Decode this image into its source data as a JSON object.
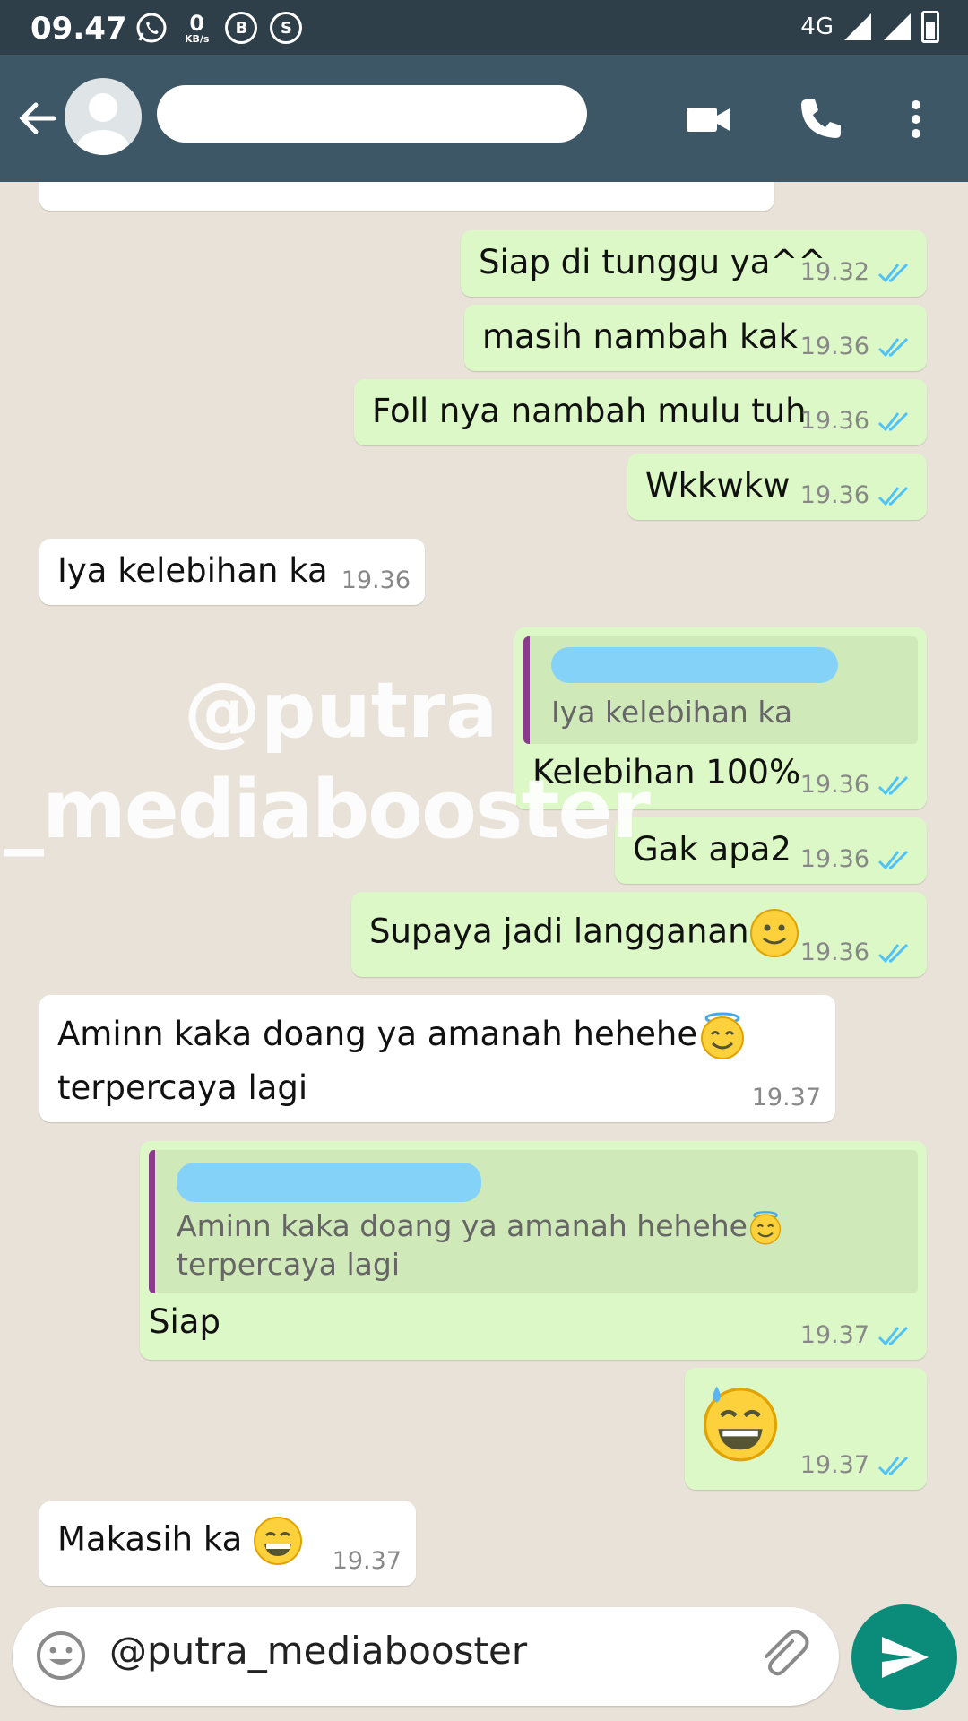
{
  "status_bar": {
    "time": "09.47",
    "net_speed": "0",
    "net_unit": "KB/s",
    "b_badge": "B",
    "s_badge": "S",
    "network": "4G"
  },
  "header": {
    "back_icon": "arrow-left-icon",
    "video_icon": "video-icon",
    "call_icon": "phone-icon",
    "menu_icon": "more-vert-icon"
  },
  "messages": [
    {
      "dir": "out",
      "text": "Siap di tunggu ya^^",
      "time": "19.32",
      "status": "read"
    },
    {
      "dir": "out",
      "text": "masih nambah kak",
      "time": "19.36",
      "status": "read"
    },
    {
      "dir": "out",
      "text": "Foll nya nambah mulu tuh",
      "time": "19.36",
      "status": "read"
    },
    {
      "dir": "out",
      "text": "Wkkwkw",
      "time": "19.36",
      "status": "read"
    },
    {
      "dir": "in",
      "text": "Iya kelebihan ka",
      "time": "19.36"
    },
    {
      "dir": "out",
      "quote": "Iya kelebihan ka",
      "text": "Kelebihan 100%",
      "time": "19.36",
      "status": "read"
    },
    {
      "dir": "out",
      "text": "Gak apa2",
      "time": "19.36",
      "status": "read"
    },
    {
      "dir": "out",
      "text": "Supaya jadi langganan",
      "emoji": "slightly-smiling-emoji",
      "time": "19.36",
      "status": "read"
    },
    {
      "dir": "in",
      "text_line1": "Aminn kaka doang ya amanah hehehe",
      "emoji": "halo-smiling-emoji",
      "text_line2": "terpercaya lagi",
      "time": "19.37"
    },
    {
      "dir": "out",
      "quote_line1": "Aminn kaka doang ya amanah hehehe",
      "quote_line2": "terpercaya lagi",
      "text": "Siap",
      "time": "19.37",
      "status": "read"
    },
    {
      "dir": "out",
      "emoji": "grinning-sweat-emoji",
      "time": "19.37",
      "status": "read"
    },
    {
      "dir": "in",
      "text": "Makasih ka",
      "emoji": "grinning-emoji",
      "time": "19.37"
    }
  ],
  "watermark": {
    "line1": "@putra",
    "line2": "_mediabooster"
  },
  "composer": {
    "value": "@putra_mediabooster",
    "emoji_icon": "emoji-icon",
    "attach_icon": "paperclip-icon",
    "send_icon": "send-icon"
  }
}
